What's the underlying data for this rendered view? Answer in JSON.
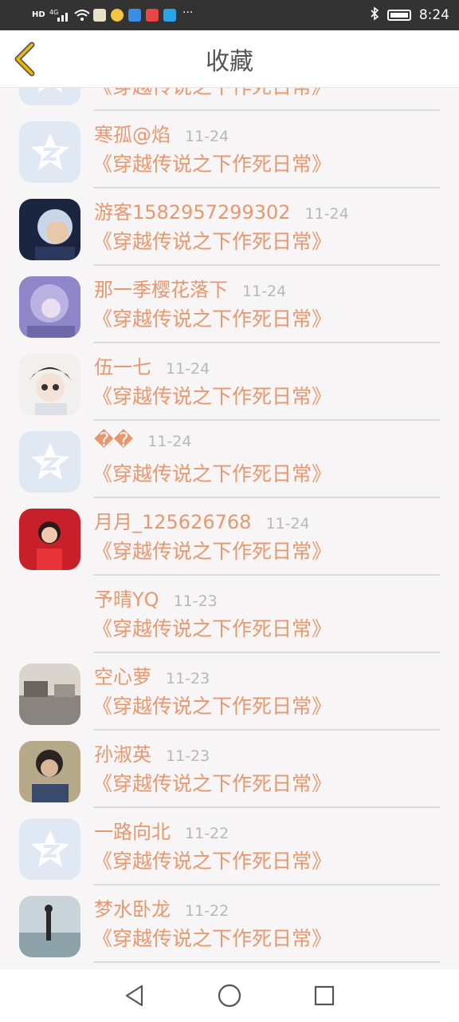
{
  "status_bar": {
    "left_icons": [
      "hd-icon",
      "4g-signal-icon",
      "wifi-icon",
      "app-icon",
      "app-icon",
      "app-icon",
      "app-icon",
      "app-icon"
    ],
    "more": "···",
    "time": "8:24"
  },
  "header": {
    "title": "收藏",
    "accent": "#f0b800"
  },
  "items": [
    {
      "name": "",
      "time": "",
      "subtitle": "《穿越传说之下作死日常》",
      "avatar": "qq"
    },
    {
      "name": "寒孤@焰",
      "time": "11-24",
      "subtitle": "《穿越传说之下作死日常》",
      "avatar": "qq"
    },
    {
      "name": "游客1582957299302",
      "time": "11-24",
      "subtitle": "《穿越传说之下作死日常》",
      "avatar": "photo-blue"
    },
    {
      "name": "那一季樱花落下",
      "time": "11-24",
      "subtitle": "《穿越传说之下作死日常》",
      "avatar": "photo-purple"
    },
    {
      "name": "伍一七",
      "time": "11-24",
      "subtitle": "《穿越传说之下作死日常》",
      "avatar": "photo-anime"
    },
    {
      "name": "��",
      "time": "11-24",
      "subtitle": "《穿越传说之下作死日常》",
      "avatar": "qq"
    },
    {
      "name": "月月_125626768",
      "time": "11-24",
      "subtitle": "《穿越传说之下作死日常》",
      "avatar": "photo-red"
    },
    {
      "name": "予晴YQ",
      "time": "11-23",
      "subtitle": "《穿越传说之下作死日常》",
      "avatar": "blank"
    },
    {
      "name": "空心萝",
      "time": "11-23",
      "subtitle": "《穿越传说之下作死日常》",
      "avatar": "photo-street"
    },
    {
      "name": "孙淑英",
      "time": "11-23",
      "subtitle": "《穿越传说之下作死日常》",
      "avatar": "photo-person"
    },
    {
      "name": "一路向北",
      "time": "11-22",
      "subtitle": "《穿越传说之下作死日常》",
      "avatar": "qq"
    },
    {
      "name": "梦水卧龙",
      "time": "11-22",
      "subtitle": "《穿越传说之下作死日常》",
      "avatar": "photo-beach"
    }
  ],
  "colors": {
    "name": "#e8986e",
    "time": "#b8b8b8",
    "qq_avatar_bg": "#dfe8f3"
  }
}
